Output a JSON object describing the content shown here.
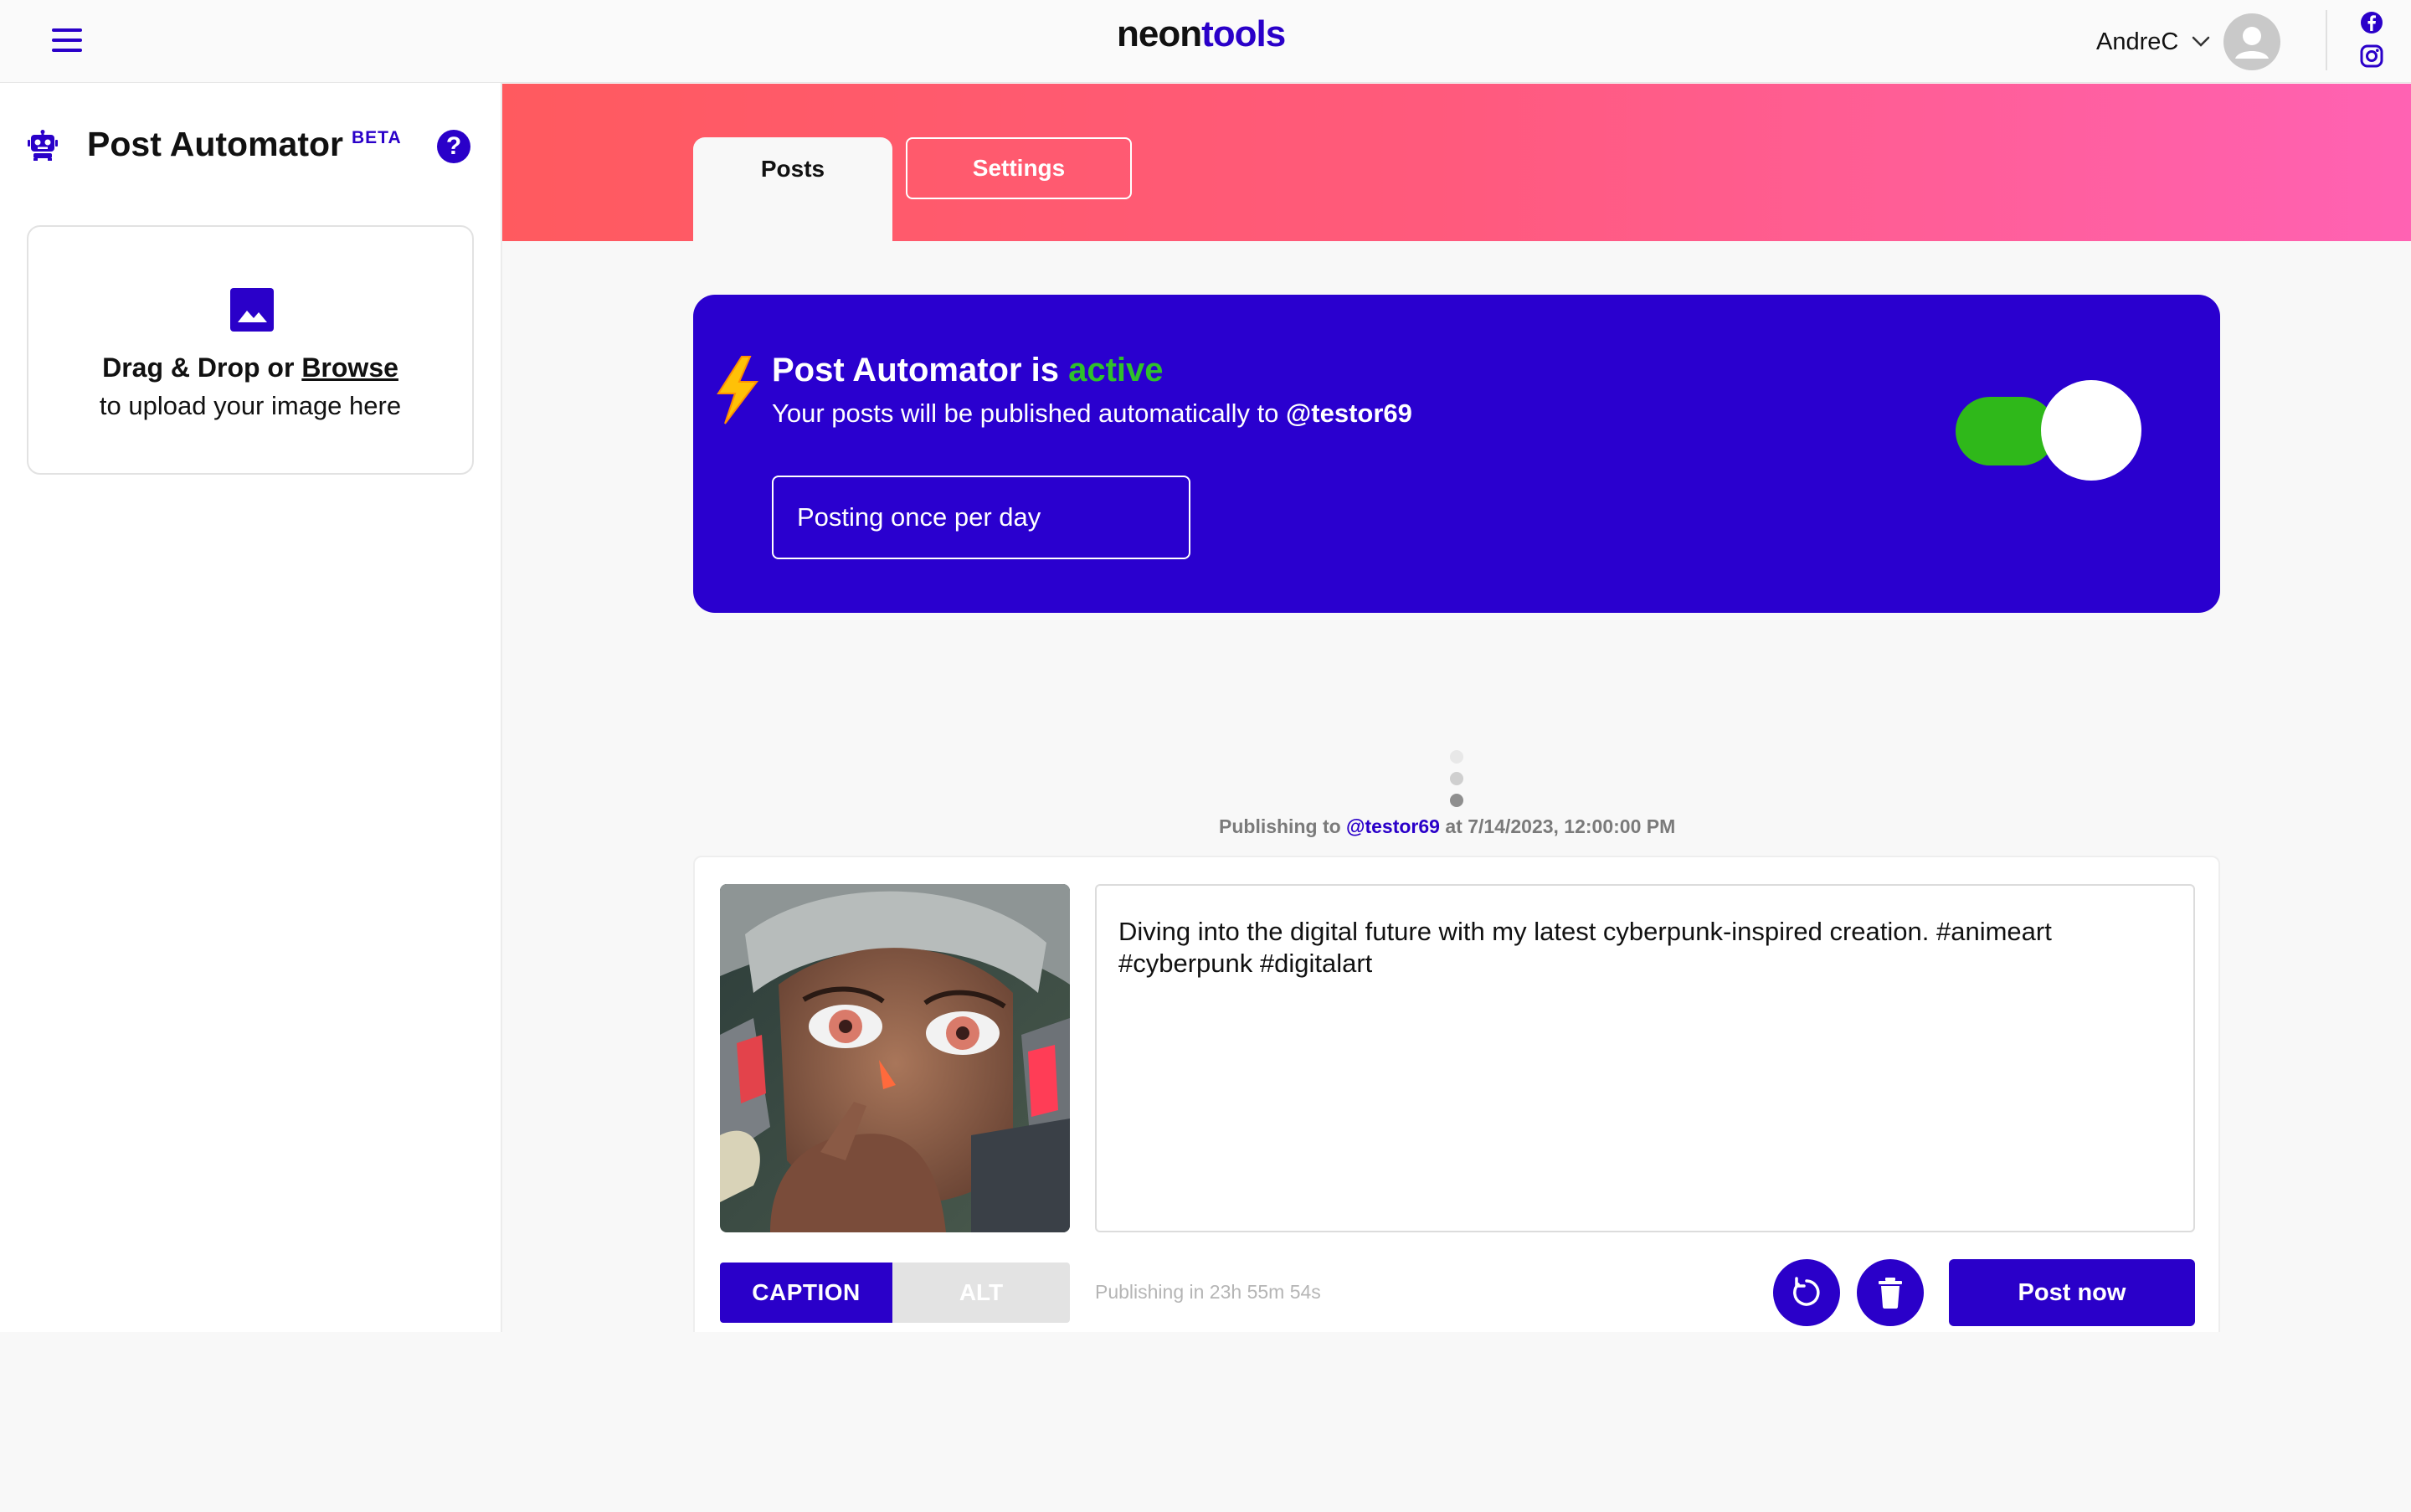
{
  "app": {
    "logo_part1": "neon",
    "logo_part2": "tools",
    "brand_color": "#2a00c9",
    "accent_green": "#2fc12b"
  },
  "header": {
    "username": "AndreC",
    "icons": [
      "menu-icon",
      "chevron-down-icon",
      "avatar",
      "facebook-icon",
      "instagram-icon"
    ]
  },
  "sidebar": {
    "title": "Post Automator",
    "badge": "BETA",
    "help": "?",
    "upload": {
      "drag_text": "Drag & Drop or ",
      "browse_text": "Browse",
      "hint": "to upload your image here"
    }
  },
  "tabs": {
    "posts": "Posts",
    "settings": "Settings",
    "selected": "Posts"
  },
  "automator": {
    "title_prefix": "Post Automator is ",
    "status": "active",
    "subtitle": "Your posts will be published automatically to ",
    "account": "@testor69",
    "frequency": "Posting once per day",
    "enabled": true
  },
  "queue": {
    "publishing_prefix": "Publishing to ",
    "account": "@testor69",
    "publishing_suffix": " at 7/14/2023, 12:00:00 PM"
  },
  "post": {
    "caption": "Diving into the digital future with my latest cyberpunk-inspired creation.  #animeart #cyberpunk #digitalart",
    "mode_caption": "CAPTION",
    "mode_alt": "ALT",
    "selected_mode": "CAPTION",
    "countdown": "Publishing in 23h 55m 54s",
    "post_now": "Post now"
  }
}
